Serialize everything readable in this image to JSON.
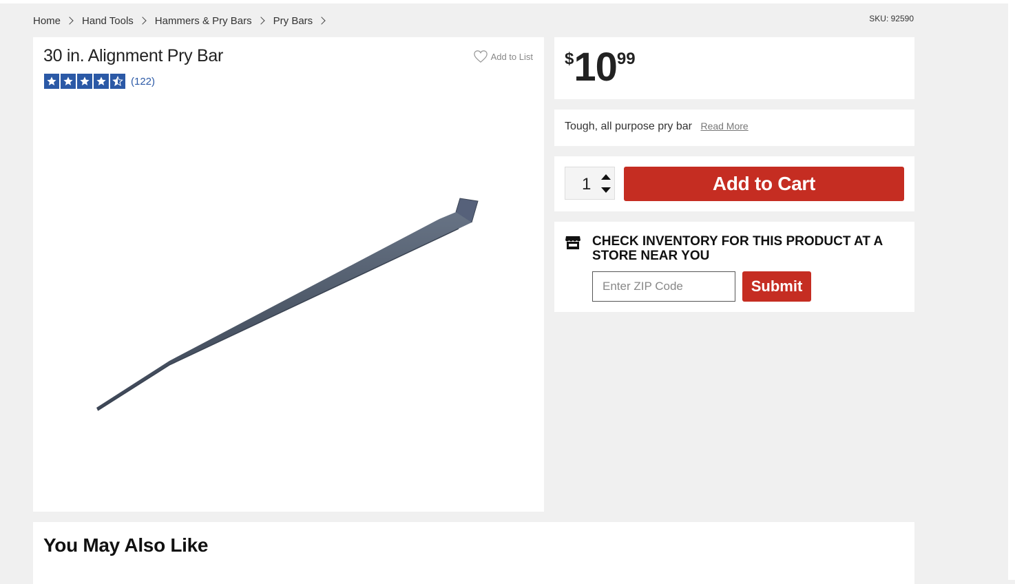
{
  "breadcrumb": {
    "items": [
      "Home",
      "Hand Tools",
      "Hammers & Pry Bars",
      "Pry Bars"
    ]
  },
  "sku": "SKU: 92590",
  "product": {
    "title": "30 in. Alignment Pry Bar",
    "rating": 4.5,
    "review_count": "(122)",
    "add_to_list": "Add to List",
    "image_icon": "pry-bar-image"
  },
  "price": {
    "currency": "$",
    "dollars": "10",
    "cents": "99"
  },
  "description": {
    "text": "Tough, all purpose pry bar",
    "read_more": "Read More"
  },
  "cart": {
    "quantity": "1",
    "add_to_cart": "Add to Cart"
  },
  "inventory": {
    "heading": "CHECK INVENTORY FOR THIS PRODUCT AT A STORE NEAR YOU",
    "zip_placeholder": "Enter ZIP Code",
    "submit": "Submit"
  },
  "recommendations": {
    "title": "You May Also Like"
  },
  "colors": {
    "accent_red": "#c52d22",
    "star_blue": "#2b59a6",
    "page_bg": "#f0f0f0"
  }
}
